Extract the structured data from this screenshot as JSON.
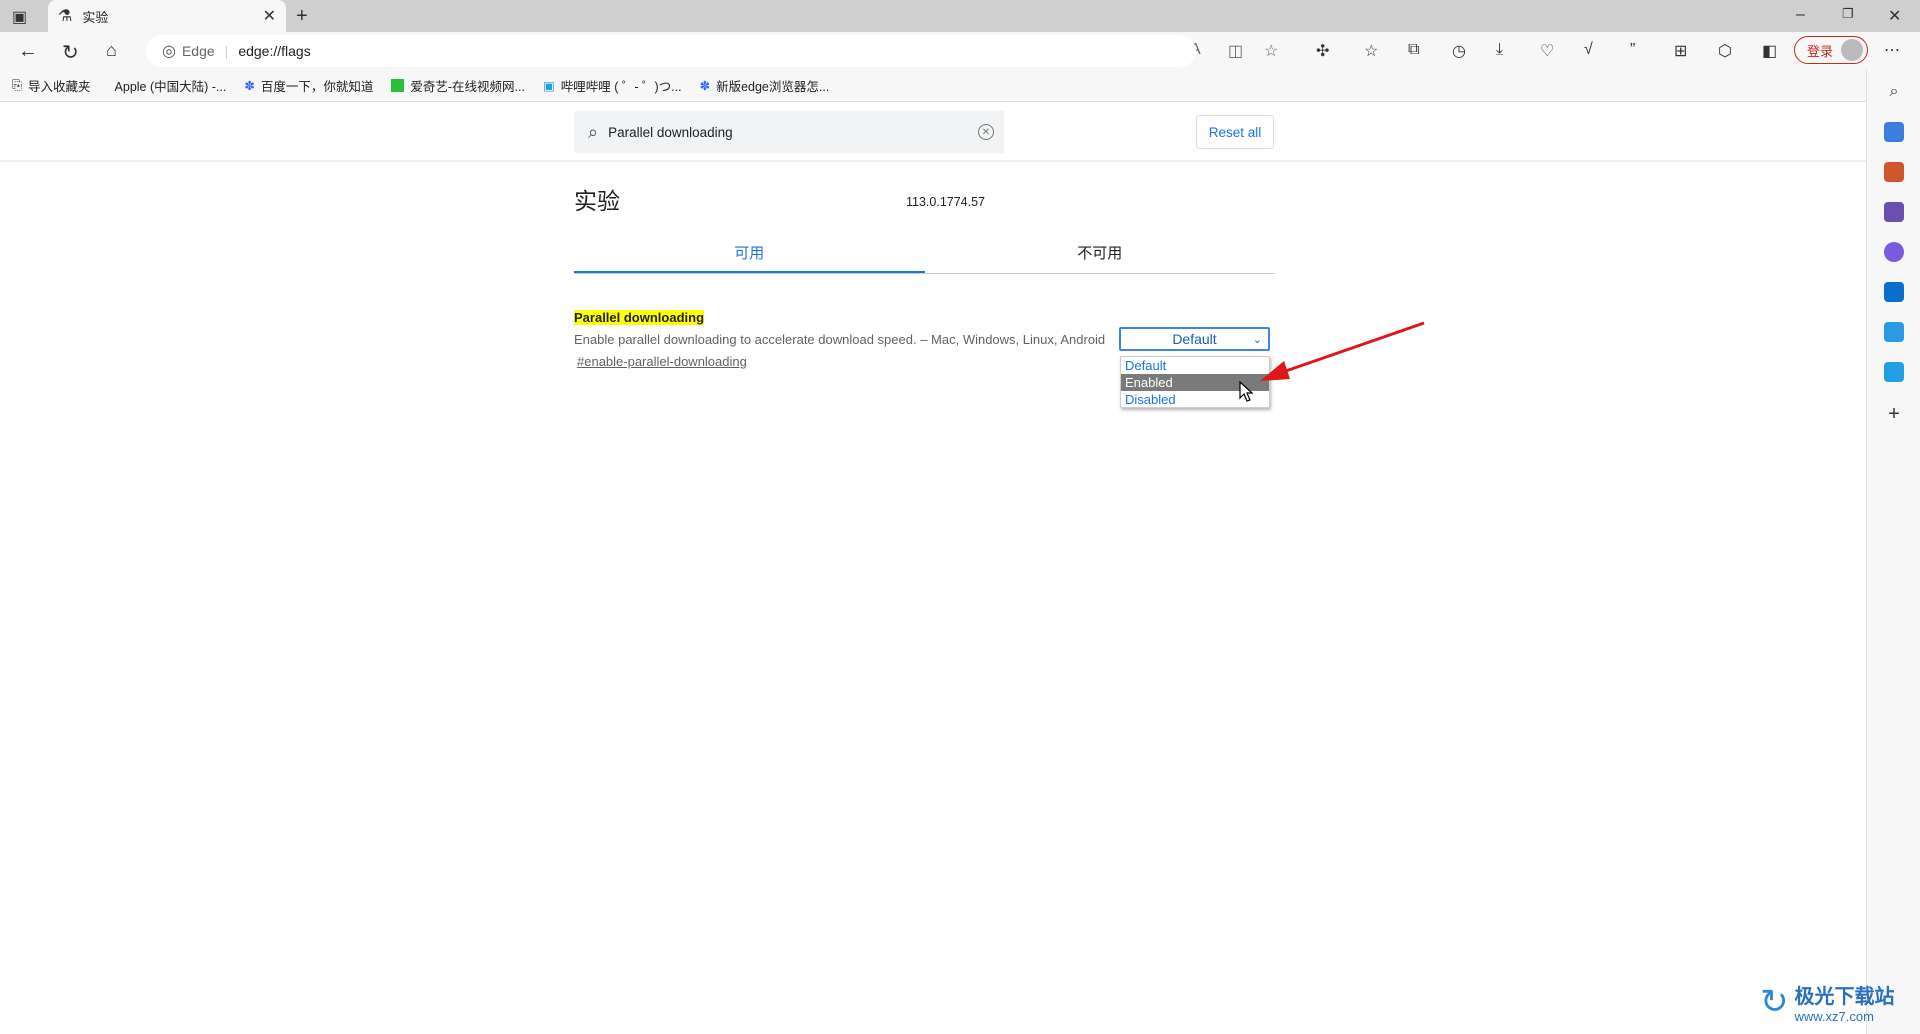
{
  "browser": {
    "tab_title": "实验",
    "address_prefix": "Edge",
    "url": "edge://flags",
    "login_label": "登录",
    "bookmarks": [
      {
        "label": "导入收藏夹",
        "icon": "import-icon"
      },
      {
        "label": "Apple (中国大陆) -...",
        "icon": "apple-icon"
      },
      {
        "label": "百度一下，你就知道",
        "icon": "baidu-icon"
      },
      {
        "label": "爱奇艺-在线视频网...",
        "icon": "iqiyi-icon"
      },
      {
        "label": "哔哩哔哩 ( ゜- ゜)つ...",
        "icon": "bilibili-icon"
      },
      {
        "label": "新版edge浏览器怎...",
        "icon": "baidu-icon"
      }
    ]
  },
  "flags": {
    "search_value": "Parallel downloading",
    "reset_label": "Reset all",
    "title": "实验",
    "version": "113.0.1774.57",
    "tabs": [
      {
        "label": "可用",
        "active": true
      },
      {
        "label": "不可用",
        "active": false
      }
    ],
    "flag": {
      "name": "Parallel downloading",
      "description": "Enable parallel downloading to accelerate download speed. – Mac, Windows, Linux, Android",
      "link": "#enable-parallel-downloading",
      "selected": "Default",
      "options": [
        "Default",
        "Enabled",
        "Disabled"
      ],
      "highlighted_option": "Enabled"
    }
  },
  "watermark": {
    "name": "极光下载站",
    "url": "www.xz7.com"
  },
  "colors": {
    "accent": "#1a73e8",
    "highlight": "#ffff00",
    "arrow": "#e0161b",
    "login": "#c42b1c"
  }
}
